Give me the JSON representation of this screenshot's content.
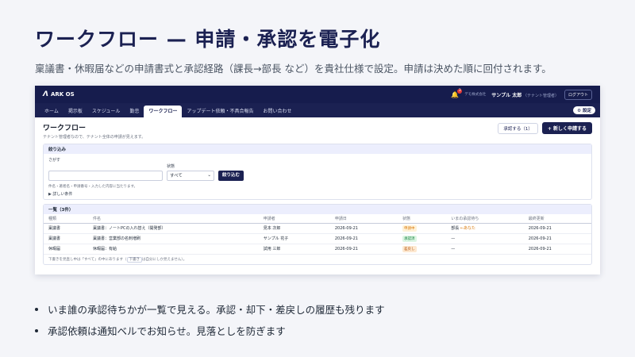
{
  "slide": {
    "title": "ワークフロー — 申請・承認を電子化",
    "subtitle": "稟議書・休暇届などの申請書式と承認経路（課長→部長 など）を貴社仕様で設定。申請は決めた順に回付されます。",
    "bullets": [
      "いま誰の承認待ちかが一覧で見える。承認・却下・差戻しの履歴も残ります",
      "承認依頼は通知ベルでお知らせ。見落としを防ぎます"
    ]
  },
  "app": {
    "logo_text": "ARK OS",
    "notification_count": "3",
    "company": "デモ株式会社",
    "user_name": "サンプル 太郎",
    "user_role": "（テナント管理者）",
    "logout_label": "ログアウト",
    "settings_label": "設定",
    "nav": [
      "ホーム",
      "掲示板",
      "スケジュール",
      "勤怠",
      "ワークフロー",
      "アップデート依頼・不具合報告",
      "お問い合わせ"
    ],
    "active_nav": "ワークフロー"
  },
  "page": {
    "title": "ワークフロー",
    "description": "テナント管理者なので、テナント全体の申請が見えます。",
    "approve_label": "承認する（1）",
    "new_label": "+ 新しく申請する"
  },
  "filter": {
    "title": "絞り込み",
    "search_label": "さがす",
    "search_value": "",
    "status_label": "状態",
    "status_value": "すべて",
    "button_label": "絞り込む",
    "hint": "件名・著者名・申請番号・入力した内容に当たります。",
    "details_label": "▶ 詳しい条件"
  },
  "list": {
    "title": "一覧（3件）",
    "columns": [
      "種類",
      "件名",
      "申請者",
      "申請日",
      "状態",
      "いまの承認待ち",
      "最終更新"
    ],
    "rows": [
      {
        "type": "稟議書",
        "subject": "稟議書：ノートPCの入れ替え（開発部）",
        "applicant": "見本 次郎",
        "date": "2026-09-21",
        "status": "申請中",
        "status_color": "#d97706",
        "status_bg": "#fff1d6",
        "waiting": "部長",
        "waiting_note": "←あなた",
        "updated": "2026-09-21"
      },
      {
        "type": "稟議書",
        "subject": "稟議書：営業部の名刺増刷",
        "applicant": "サンプル 花子",
        "date": "2026-09-21",
        "status": "承認済",
        "status_color": "#15803d",
        "status_bg": "#dcf5e3",
        "waiting": "—",
        "waiting_note": "",
        "updated": "2026-09-21"
      },
      {
        "type": "休暇届",
        "subject": "休暇届：有給",
        "applicant": "試用 三郎",
        "date": "2026-09-21",
        "status": "差戻し",
        "status_color": "#b45309",
        "status_bg": "#fde8d0",
        "waiting": "—",
        "waiting_note": "",
        "updated": "2026-09-21"
      }
    ],
    "note_before": "下書きを見直し中は「すべて」の中にあります（",
    "note_chip": "下書き",
    "note_after": "は自分にしか見えません）。"
  }
}
